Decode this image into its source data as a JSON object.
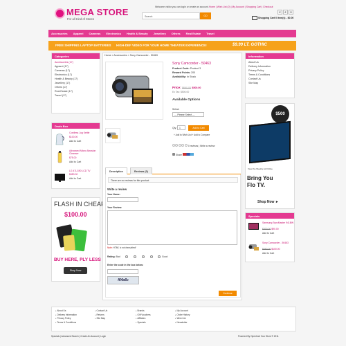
{
  "header": {
    "logo_text": "MEGA STORE",
    "tagline": "For all Kind of Stores",
    "welcome": "Welcome visitor you can login or create an account.",
    "top_links": "Home | Wish List (0) | My Account | Shopping Cart | Checkout",
    "search_placeholder": "Search",
    "search_button": "GO",
    "currencies": [
      "€",
      "£",
      "$"
    ],
    "cart": "Shopping Cart  0 item(s) - $0.00"
  },
  "nav": {
    "items": [
      "Accessories",
      "Apparel",
      "Cameras",
      "Electronics",
      "Health & Beauty",
      "Jewellery",
      "Others",
      "Real Estate",
      "Travel"
    ]
  },
  "promo": {
    "left": "FREE SHIPPING LAPTOP BATTERIES",
    "middle": "HIGH-DEF VIDEO FOR YOUR HOME THEATER EXPERIENCE!",
    "right": "$9.99 LT. GOTHIC"
  },
  "categories": {
    "title": "Categories",
    "items": [
      "Accessories (17)",
      "Apparel (17)",
      "Cameras (17)",
      "Electronics (17)",
      "Health & Beauty (17)",
      "Jewellery (17)",
      "Others (17)",
      "Real Estate (17)",
      "Travel (17)"
    ]
  },
  "deals": {
    "title": "Deals Box",
    "items": [
      {
        "name": "Cordless Jug Kettle",
        "price": "$100.00",
        "add": "Add to Cart"
      },
      {
        "name": "Advanced Micro Abrasion Cleanser",
        "price": "$75.00",
        "add": "Add to Cart"
      },
      {
        "name": "LG 47LG90 LCD TV",
        "price": "$450.00",
        "add": "Add to Cart"
      }
    ]
  },
  "flash_ad": {
    "title": "FLASH IN CHEAP",
    "price": "$100.00",
    "tagline": "BUY HERE, PLY LESS",
    "button": "Shop Now"
  },
  "breadcrumb": "Home  »  Accessories  »  Sony Camcorder - 50463",
  "product": {
    "name": "Sony Camcorder - 50463",
    "code_label": "Product Code:",
    "code": "Product 3",
    "reward_label": "Reward Points:",
    "reward": "200",
    "avail_label": "Availability:",
    "avail": "In Stock",
    "price_label": "Price:",
    "price_old": "$660.00",
    "price_new": "$500.00",
    "ex_tax": "Ex Tax: $500.00",
    "options_title": "Available Options",
    "select_label": "Select:",
    "select_value": "--- Please Select ---",
    "qty_label": "Qty:",
    "qty_value": "1",
    "add_to_cart": "Add to Cart",
    "wishlist": "+ Add to Wish List     + Add to Compare",
    "reviews": "0 reviews  |  Write a review",
    "share": "Share"
  },
  "tabs": {
    "description": "Description",
    "reviews": "Reviews (0)"
  },
  "review_form": {
    "no_reviews": "There are no reviews for this product.",
    "heading": "Write a review",
    "name_label": "Your Name:",
    "review_label": "Your Review:",
    "note_prefix": "Note:",
    "note_text": " HTML is not translated!",
    "rating_label": "Rating:",
    "bad": "Bad",
    "good": "Good",
    "code_label": "Enter the code in the box below:",
    "captcha": "f64a6c",
    "continue": "Continue"
  },
  "information": {
    "title": "Information",
    "items": [
      "About Us",
      "Delivery Information",
      "Privacy Policy",
      "Terms & Conditions",
      "Contact Us",
      "Site Map"
    ]
  },
  "tv_ad": {
    "price": "$500",
    "view": "View the Weekly Ad Online",
    "bring1": "Bring You",
    "bring2": "Flo TV.",
    "shop": "Shop Now ►"
  },
  "specials": {
    "title": "Specials",
    "items": [
      {
        "name": "Samsung SyncMaster 941BW",
        "old": "$300.00",
        "new": "$90.00",
        "add": "Add to Cart"
      },
      {
        "name": "Sony Camcorder - 50463",
        "old": "$660.00",
        "new": "$100.00",
        "add": "Add to Cart"
      }
    ]
  },
  "footer": {
    "col1": [
      "About Us",
      "Delivery Information",
      "Privacy Policy",
      "Terms & Conditions"
    ],
    "col2": [
      "Contact Us",
      "Returns",
      "Site Map"
    ],
    "col3": [
      "Brands",
      "Gift Vouchers",
      "Affiliates",
      "Specials"
    ],
    "col4": [
      "My Account",
      "Order History",
      "Wish List",
      "Newsletter"
    ],
    "bottom_links": "Specials  |  Advanced Search  |  Create An Account  |  Login",
    "powered": "Powered By OpenCart Your Store © 2011"
  },
  "colors": {
    "brand_pink": "#e43a91",
    "accent_orange": "#f28a00",
    "link": "#c8106e"
  }
}
